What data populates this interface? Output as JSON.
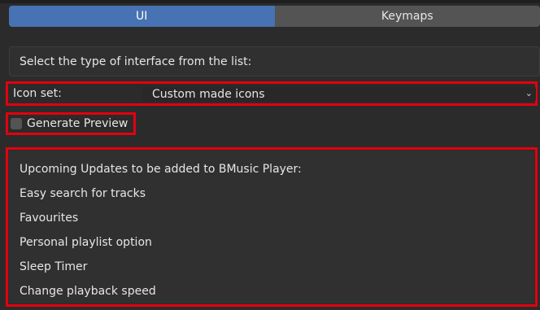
{
  "tabs": [
    {
      "label": "UI",
      "active": true
    },
    {
      "label": "Keymaps",
      "active": false
    }
  ],
  "info": {
    "text": "Select the type of interface from the list:"
  },
  "icon_set": {
    "label": "Icon set:",
    "value": "Custom made icons"
  },
  "preview": {
    "label": "Generate Preview",
    "checked": false
  },
  "updates": {
    "lines": [
      "Upcoming Updates to be added to BMusic Player:",
      "Easy search for tracks",
      "Favourites",
      "Personal playlist option",
      "Sleep Timer",
      "Change playback speed"
    ]
  },
  "colors": {
    "accent": "#4772b3",
    "highlight_border": "#e3000f",
    "background": "#2b2b2b"
  }
}
